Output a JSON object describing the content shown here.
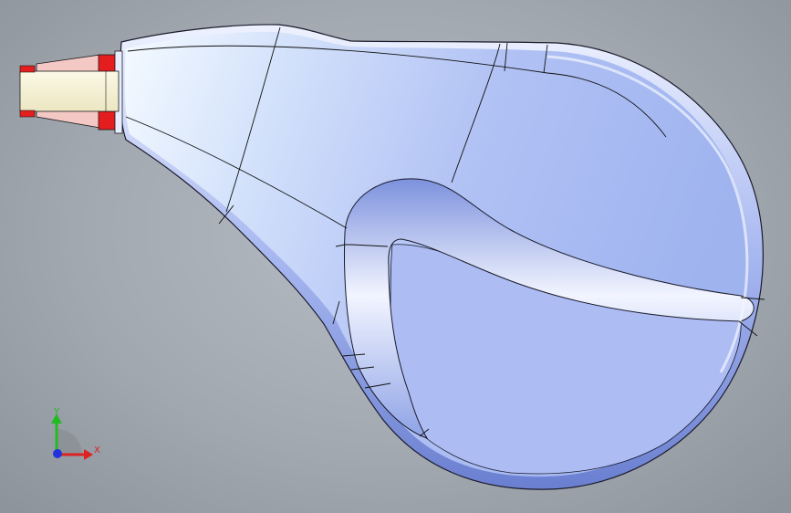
{
  "viewport": {
    "background": "#a9afb7",
    "part_color": "#a9b9f4",
    "edge_color": "#000000",
    "connector_color": "#e01010"
  },
  "triad": {
    "y_label": "Y",
    "x_label": "X",
    "y_color": "#22bb22",
    "x_color": "#dd2222",
    "z_color": "#2233dd"
  }
}
